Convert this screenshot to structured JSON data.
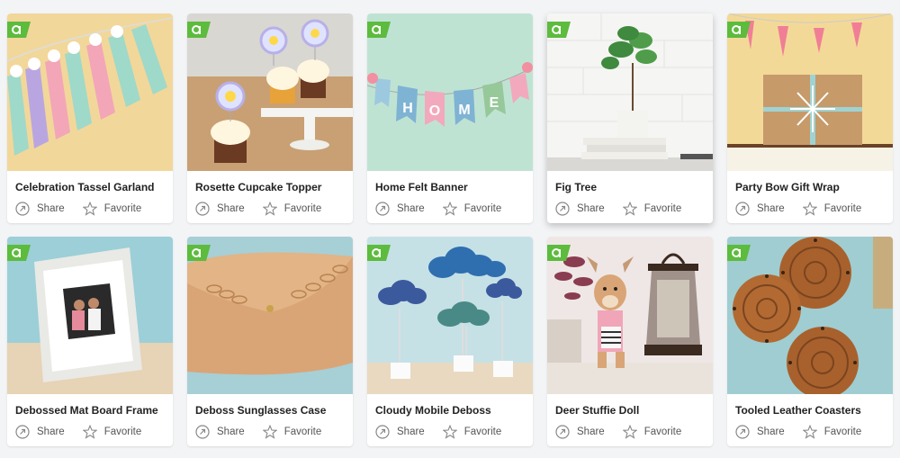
{
  "colors": {
    "badge": "#5dbb3e",
    "page_bg": "#f3f4f6",
    "card_bg": "#ffffff"
  },
  "badge_icon": "brand-a-logo",
  "cards": [
    {
      "title": "Celebration Tassel Garland",
      "share_label": "Share",
      "favorite_label": "Favorite"
    },
    {
      "title": "Rosette Cupcake Topper",
      "share_label": "Share",
      "favorite_label": "Favorite"
    },
    {
      "title": "Home Felt Banner",
      "share_label": "Share",
      "favorite_label": "Favorite",
      "banner_letters": [
        "H",
        "O",
        "M",
        "E"
      ]
    },
    {
      "title": "Fig Tree",
      "share_label": "Share",
      "favorite_label": "Favorite"
    },
    {
      "title": "Party Bow Gift Wrap",
      "share_label": "Share",
      "favorite_label": "Favorite"
    },
    {
      "title": "Debossed Mat Board Frame",
      "share_label": "Share",
      "favorite_label": "Favorite"
    },
    {
      "title": "Deboss Sunglasses Case",
      "share_label": "Share",
      "favorite_label": "Favorite"
    },
    {
      "title": "Cloudy Mobile Deboss",
      "share_label": "Share",
      "favorite_label": "Favorite"
    },
    {
      "title": "Deer Stuffie Doll",
      "share_label": "Share",
      "favorite_label": "Favorite"
    },
    {
      "title": "Tooled Leather Coasters",
      "share_label": "Share",
      "favorite_label": "Favorite"
    }
  ]
}
